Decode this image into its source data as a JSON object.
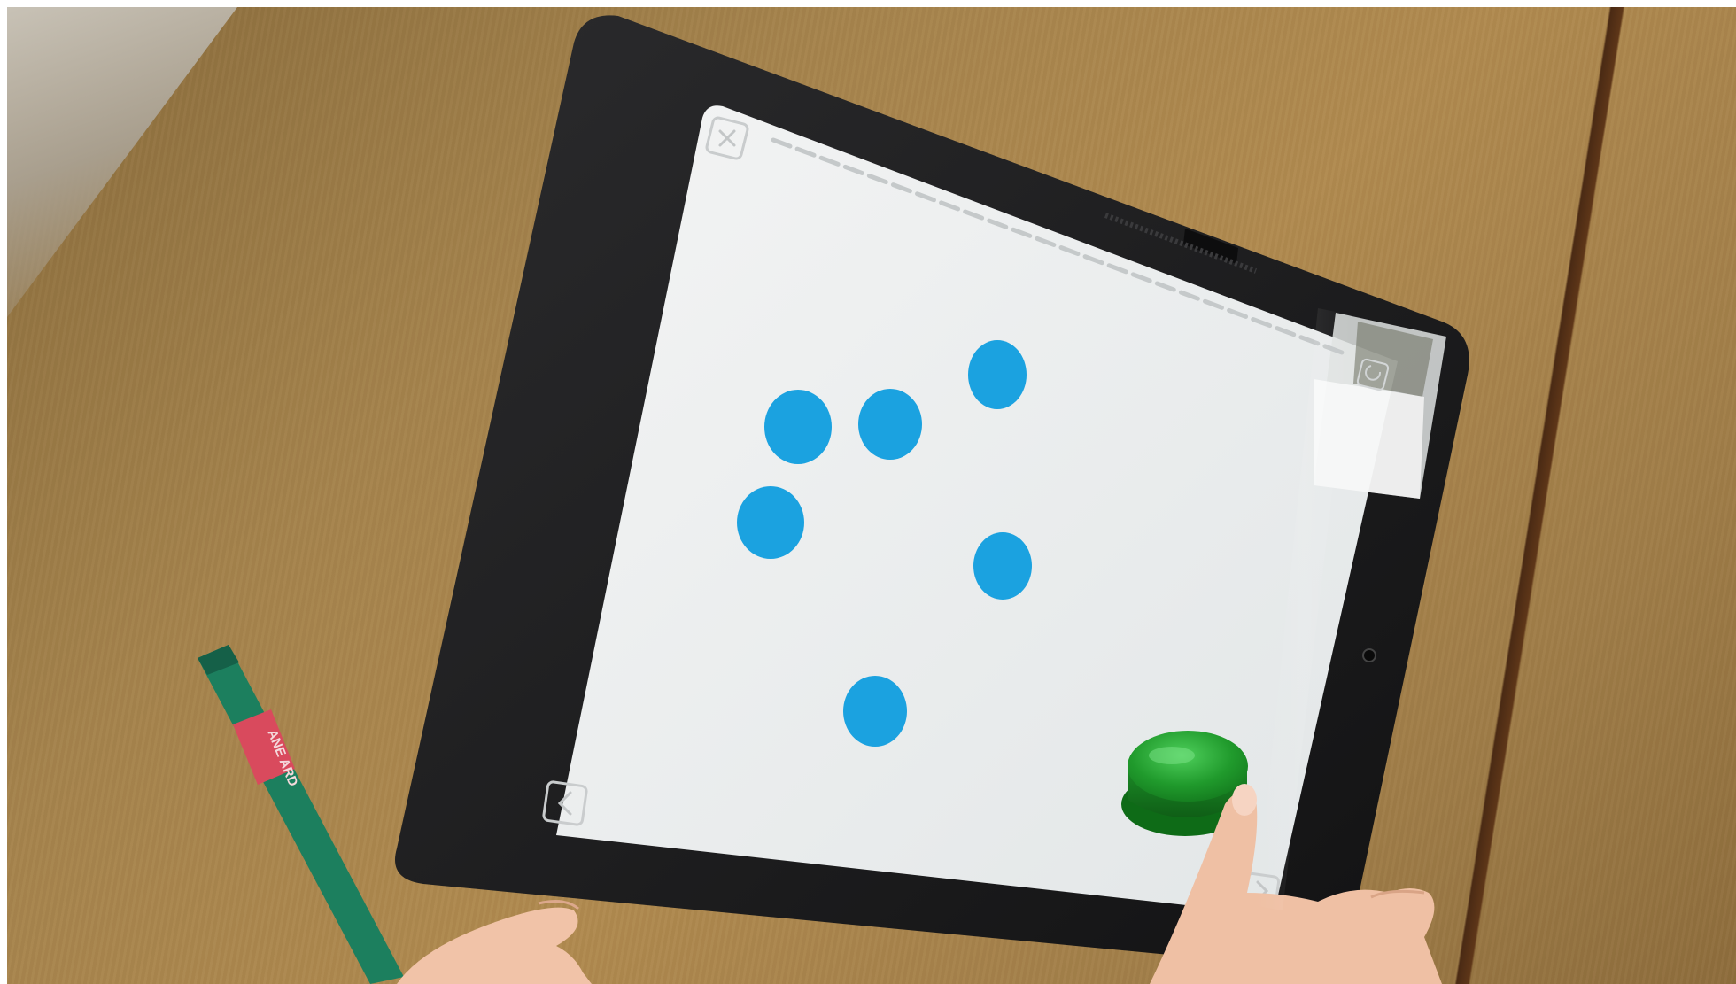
{
  "scene": {
    "description_tag": "tablet-on-table",
    "colors": {
      "table": "#a5834c",
      "tablet_case": "#1c1c1e",
      "screen": "#eceff0",
      "dot": "#1aa0de",
      "button": "#1f9a2e",
      "marker": "#1f8a66",
      "label": "#e05563"
    }
  },
  "app": {
    "close_icon": "close-icon",
    "back_icon": "chevron-left-icon",
    "next_icon": "chevron-right-icon",
    "restart_icon": "refresh-icon",
    "progress_segments": 24,
    "dot_count": 6,
    "button_icon": "green-push-button"
  },
  "marker": {
    "label_text": "ANE ARD"
  }
}
